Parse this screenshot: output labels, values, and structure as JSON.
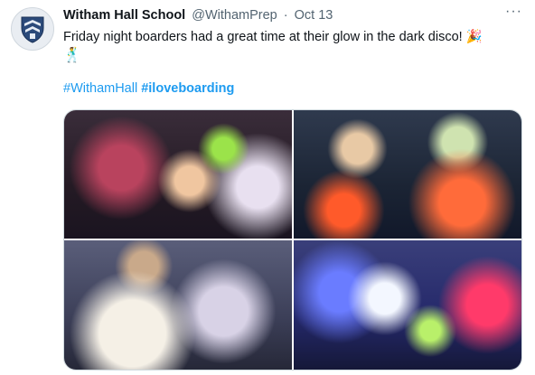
{
  "tweet": {
    "author_name": "Witham Hall School",
    "handle": "@WithamPrep",
    "separator": "·",
    "date": "Oct 13",
    "more_label": "···",
    "text_line1": "Friday night boarders had a great time at their glow in the dark disco!",
    "emoji_1": "🎉",
    "emoji_2": "🕺",
    "hashtags": [
      {
        "text": "#WithamHall",
        "bold": false
      },
      {
        "text": "#iloveboarding",
        "bold": true
      }
    ]
  },
  "colors": {
    "link": "#1d9bf0",
    "secondary_text": "#536471",
    "primary_text": "#0f1419",
    "media_border": "#cfd9de"
  },
  "media": {
    "count": 4,
    "photos": [
      {
        "id": "photo-1",
        "description_icon": "photo"
      },
      {
        "id": "photo-2",
        "description_icon": "photo"
      },
      {
        "id": "photo-3",
        "description_icon": "photo"
      },
      {
        "id": "photo-4",
        "description_icon": "photo"
      }
    ]
  }
}
